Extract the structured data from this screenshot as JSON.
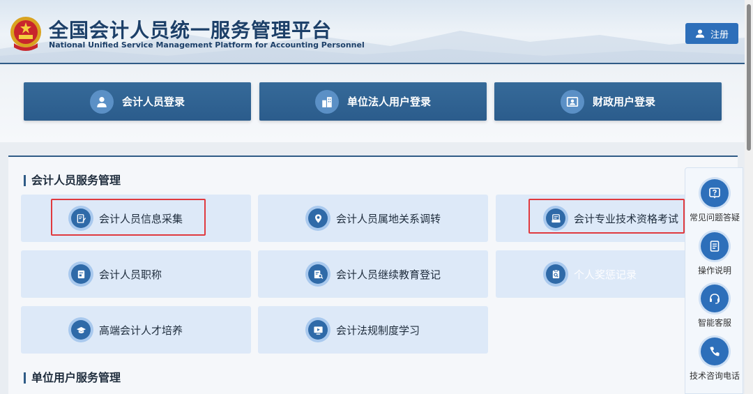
{
  "header": {
    "title_cn": "全国会计人员统一服务管理平台",
    "title_en": "National Unified Service Management Platform for Accounting Personnel",
    "register_label": "注册",
    "register_icon": "user-icon"
  },
  "login": [
    {
      "label": "会计人员登录",
      "icon": "person-icon"
    },
    {
      "label": "单位法人用户登录",
      "icon": "building-icon"
    },
    {
      "label": "财政用户登录",
      "icon": "id-card-icon"
    }
  ],
  "sections": [
    {
      "title": "会计人员服务管理"
    },
    {
      "title": "单位用户服务管理"
    }
  ],
  "services": [
    {
      "label": "会计人员信息采集",
      "icon": "form-edit-icon",
      "highlighted": true
    },
    {
      "label": "会计人员属地关系调转",
      "icon": "location-icon",
      "highlighted": false
    },
    {
      "label": "会计专业技术资格考试",
      "icon": "exam-icon",
      "highlighted": true
    },
    {
      "label": "会计人员职称",
      "icon": "document-icon",
      "highlighted": false
    },
    {
      "label": "会计人员继续教育登记",
      "icon": "document-search-icon",
      "highlighted": false
    },
    {
      "label": "个人奖惩记录",
      "icon": "record-search-icon",
      "highlighted": false
    },
    {
      "label": "高端会计人才培养",
      "icon": "graduation-cap-icon",
      "highlighted": false
    },
    {
      "label": "会计法规制度学习",
      "icon": "video-play-icon",
      "highlighted": false
    }
  ],
  "floating_toolbar": [
    {
      "label": "常见问题答疑",
      "icon": "question-icon"
    },
    {
      "label": "操作说明",
      "icon": "manual-icon"
    },
    {
      "label": "智能客服",
      "icon": "headset-icon"
    },
    {
      "label": "技术咨询电话",
      "icon": "phone-icon"
    }
  ],
  "colors": {
    "primary": "#2d6fba",
    "login_button": "#2b5c8c",
    "service_card": "#dde9f8",
    "highlight_border": "#e0393e",
    "title": "#1c3f68"
  }
}
